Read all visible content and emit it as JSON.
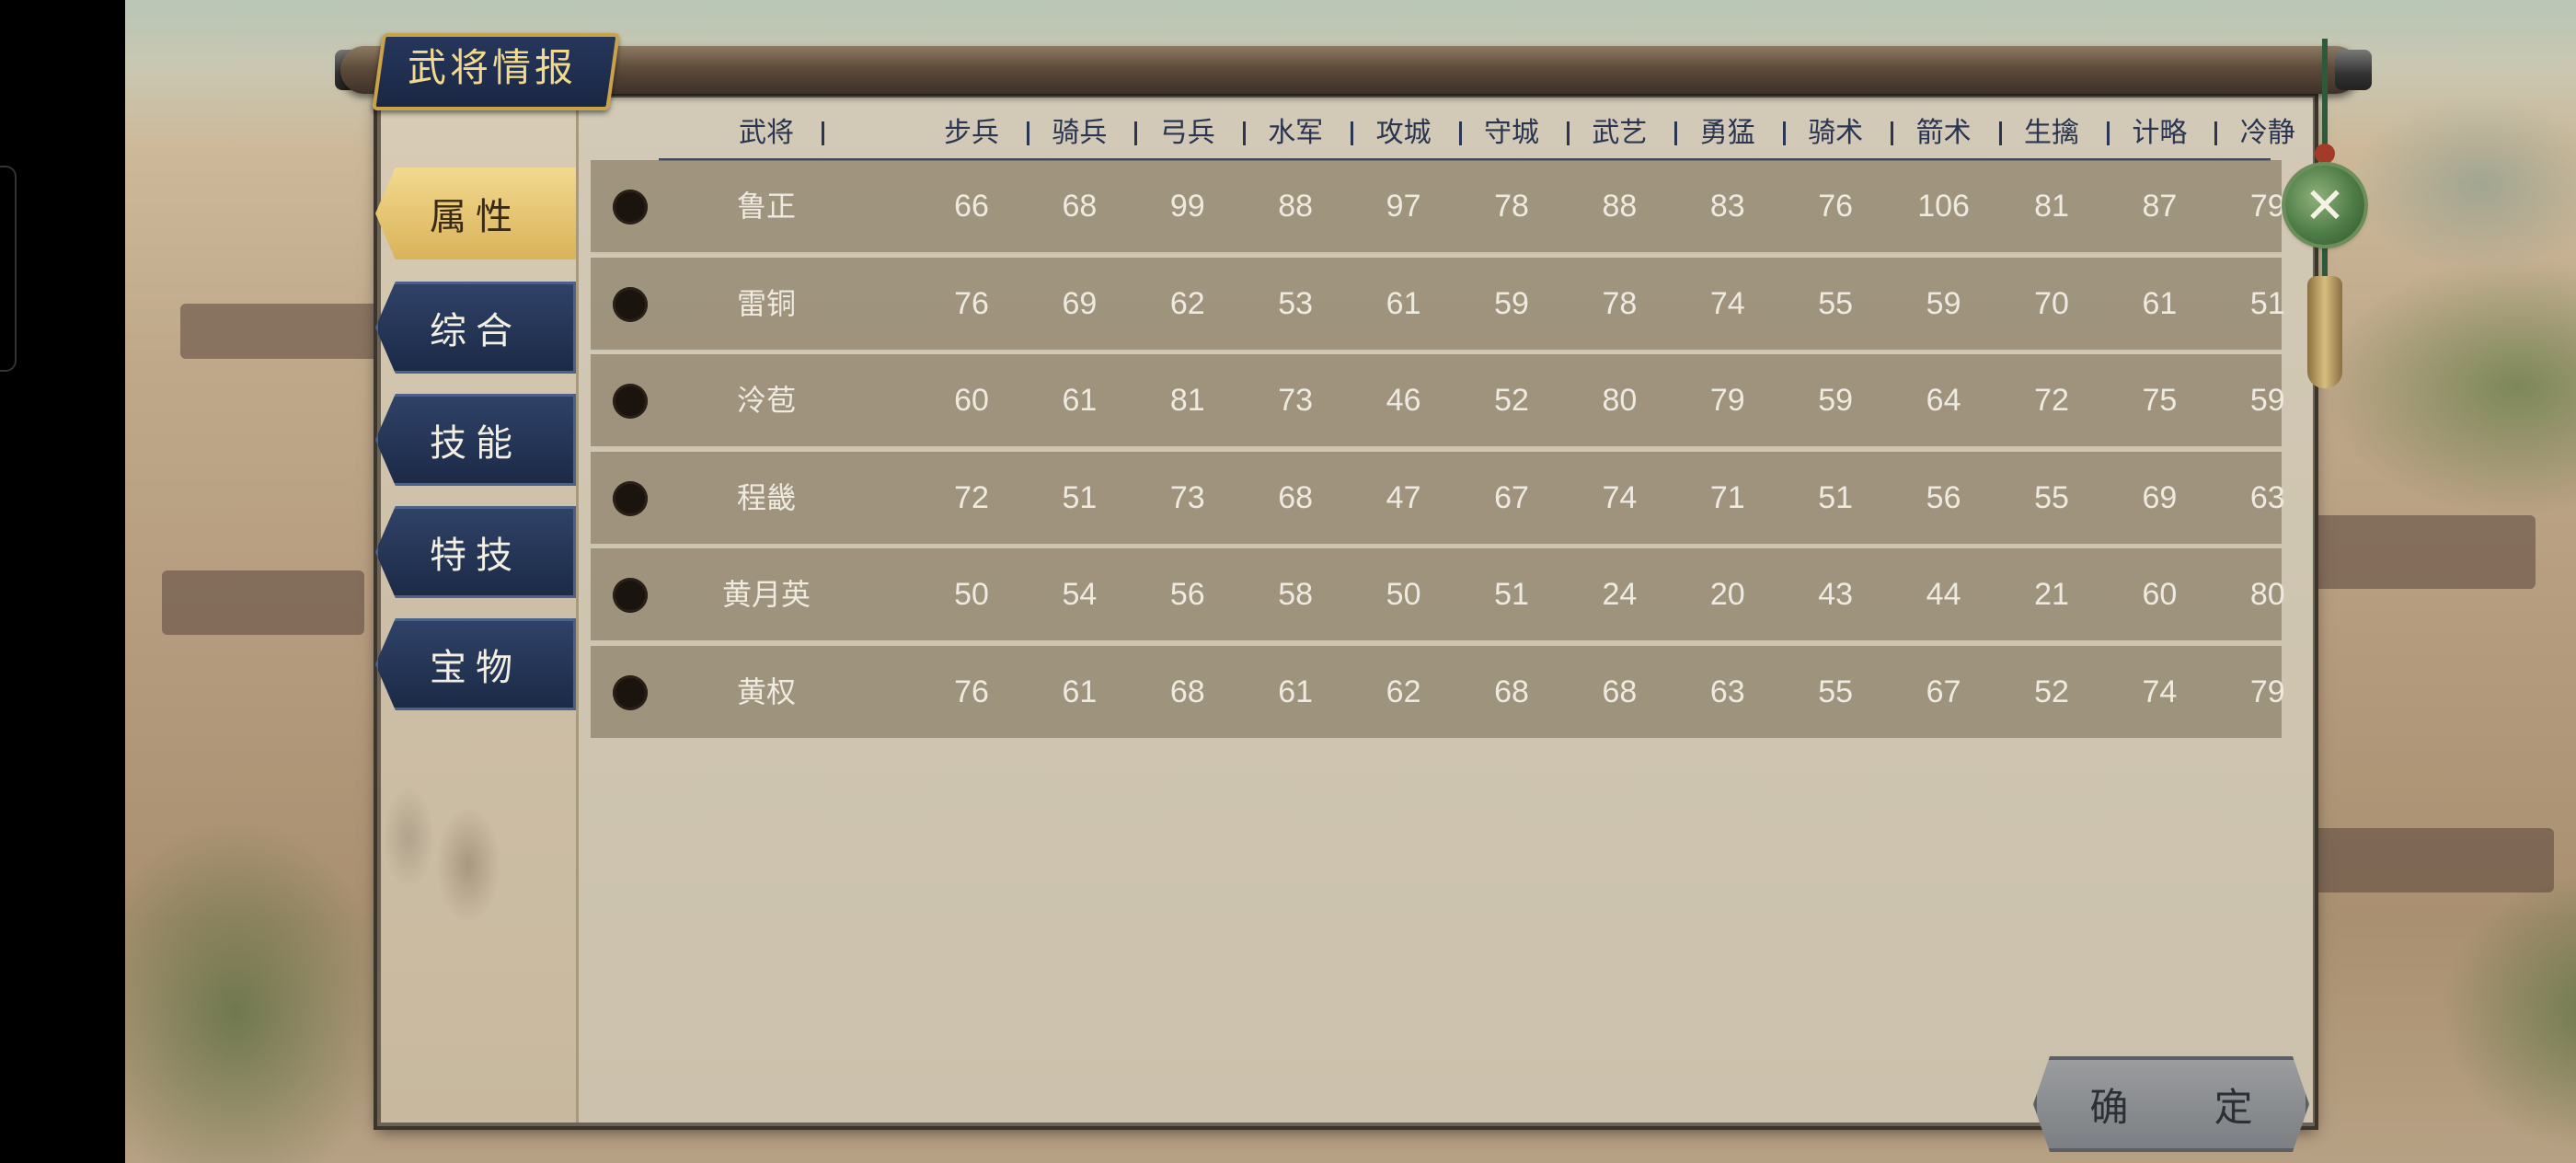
{
  "window": {
    "title": "武将情报"
  },
  "tabs": [
    {
      "label": "属性",
      "active": true
    },
    {
      "label": "综合",
      "active": false
    },
    {
      "label": "技能",
      "active": false
    },
    {
      "label": "特技",
      "active": false
    },
    {
      "label": "宝物",
      "active": false
    }
  ],
  "table": {
    "headers": [
      "武将",
      "步兵",
      "骑兵",
      "弓兵",
      "水军",
      "攻城",
      "守城",
      "武艺",
      "勇猛",
      "骑术",
      "箭术",
      "生擒",
      "计略",
      "冷静"
    ],
    "rows": [
      {
        "name": "鲁正",
        "values": [
          "66",
          "68",
          "99",
          "88",
          "97",
          "78",
          "88",
          "83",
          "76",
          "106",
          "81",
          "87",
          "79"
        ]
      },
      {
        "name": "雷铜",
        "values": [
          "76",
          "69",
          "62",
          "53",
          "61",
          "59",
          "78",
          "74",
          "55",
          "59",
          "70",
          "61",
          "51"
        ]
      },
      {
        "name": "泠苞",
        "values": [
          "60",
          "61",
          "81",
          "73",
          "46",
          "52",
          "80",
          "79",
          "59",
          "64",
          "72",
          "75",
          "59"
        ]
      },
      {
        "name": "程畿",
        "values": [
          "72",
          "51",
          "73",
          "68",
          "47",
          "67",
          "74",
          "71",
          "51",
          "56",
          "55",
          "69",
          "63"
        ]
      },
      {
        "name": "黄月英",
        "values": [
          "50",
          "54",
          "56",
          "58",
          "50",
          "51",
          "24",
          "20",
          "43",
          "44",
          "21",
          "60",
          "80"
        ]
      },
      {
        "name": "黄权",
        "values": [
          "76",
          "61",
          "68",
          "61",
          "62",
          "68",
          "68",
          "63",
          "55",
          "67",
          "52",
          "74",
          "79"
        ]
      }
    ]
  },
  "buttons": {
    "confirm_label": "确 定",
    "close_icon": "close-icon"
  },
  "colors": {
    "header_text": "#2a3552",
    "row_bg": "#8c806a",
    "cell_text": "#eeeae0",
    "tab_active": "#e6c46f",
    "tab_inactive": "#24345a"
  }
}
